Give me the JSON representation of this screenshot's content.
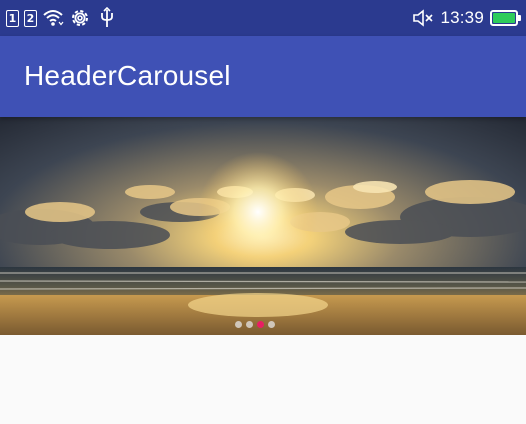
{
  "status_bar": {
    "sim1_label": "1",
    "sim2_label": "2",
    "time": "13:39",
    "battery_level": 1.0,
    "icons": [
      "sim1-icon",
      "sim2-icon",
      "wifi-icon",
      "settings-icon",
      "usb-icon",
      "mute-icon",
      "battery-icon"
    ]
  },
  "app_bar": {
    "title": "HeaderCarousel",
    "color": "#3f51b5"
  },
  "carousel": {
    "image_description": "sunset-over-ocean",
    "slide_count": 4,
    "active_index": 2,
    "active_color": "#e91e63"
  }
}
